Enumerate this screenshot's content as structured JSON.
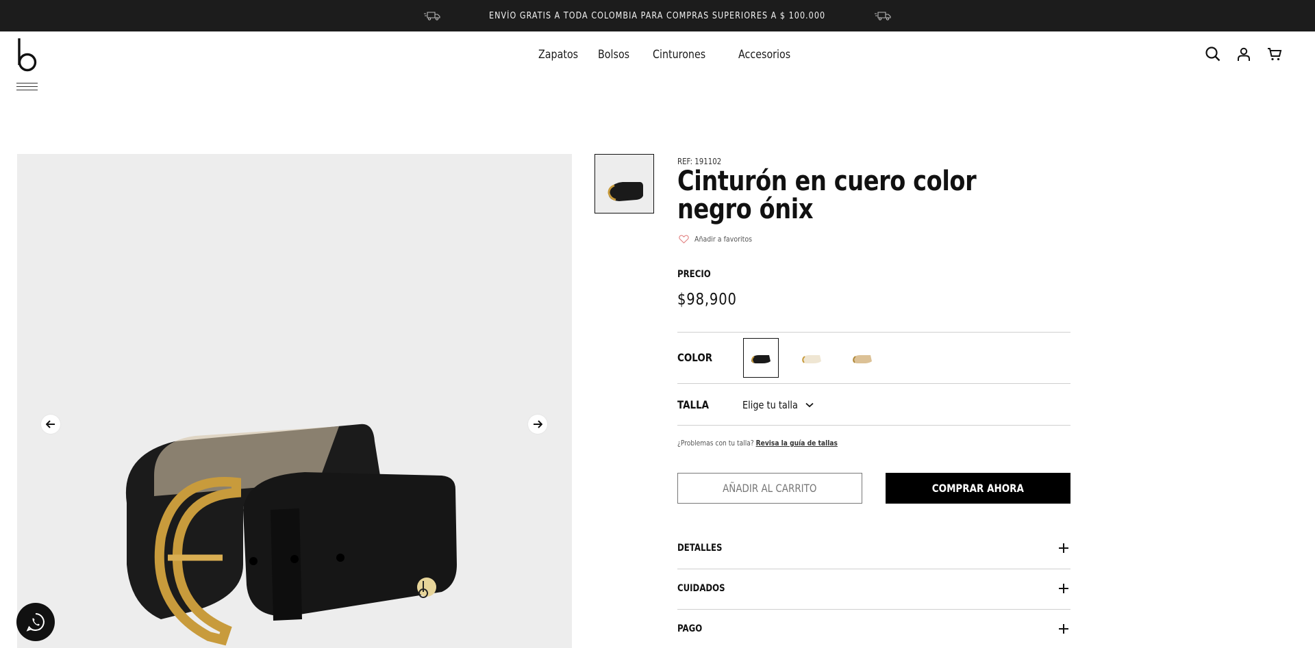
{
  "announcement": {
    "text": "ENVÍO GRATIS A TODA COLOMBIA PARA COMPRAS SUPERIORES A $ 100.000",
    "left_icon": "truck-icon",
    "right_icon": "truck-icon"
  },
  "header": {
    "logo_icon": "brand-b-logo",
    "menu_icon": "hamburger-menu-icon",
    "nav": [
      "Zapatos",
      "Bolsos",
      "Cinturones",
      "Accesorios"
    ],
    "icons": [
      "search-icon",
      "user-icon",
      "cart-icon"
    ]
  },
  "gallery": {
    "prev_icon": "arrow-left-icon",
    "next_icon": "arrow-right-icon",
    "whatsapp_icon": "whatsapp-icon"
  },
  "product": {
    "ref": "REF: 191102",
    "title": "Cinturón en cuero color negro ónix",
    "favorite_label": "Añadir a favoritos",
    "price_label": "PRECIO",
    "price": "$98,900",
    "color_label": "COLOR",
    "colors": [
      "black",
      "cream",
      "tan"
    ],
    "size_label": "TALLA",
    "size_value": "Elige tu talla",
    "size_help_text": "¿Problemas con tu talla?",
    "size_help_link": "Revisa la guía de tallas",
    "add_to_cart": "AÑADIR AL CARRITO",
    "buy_now": "COMPRAR AHORA",
    "accordions": [
      "DETALLES",
      "CUIDADOS",
      "PAGO"
    ]
  },
  "colors": {
    "announcement_bg": "#1c1c1c",
    "image_bg": "#ededed",
    "primary_button": "#000000",
    "divider": "#cfcfcf"
  }
}
